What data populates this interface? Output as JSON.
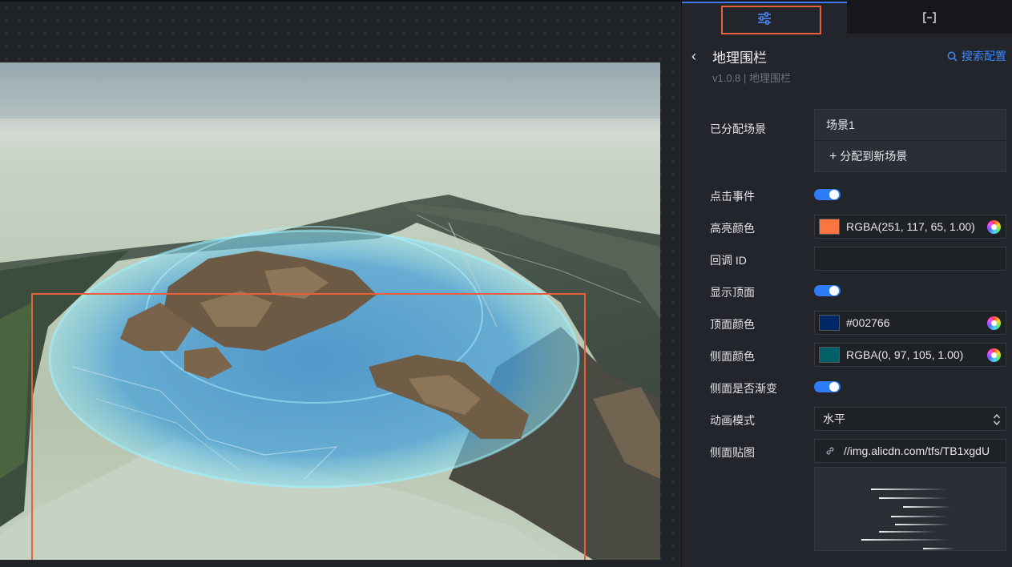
{
  "panel": {
    "tabs": [
      {
        "icon": "sliders-icon"
      },
      {
        "icon": "collapse-icon"
      }
    ],
    "title": "地理围栏",
    "subtitle": "v1.0.8 | 地理围栏",
    "search_label": "搜索配置",
    "fields": {
      "scenes_label": "已分配场景",
      "scene_item": "场景1",
      "scene_add": "分配到新场景",
      "click_event_label": "点击事件",
      "click_event_on": true,
      "highlight_color_label": "高亮颜色",
      "highlight_color_value": "RGBA(251, 117, 65, 1.00)",
      "highlight_color_hex": "#fb7541",
      "callback_id_label": "回调 ID",
      "callback_id_value": "",
      "show_top_label": "显示顶面",
      "show_top_on": true,
      "top_color_label": "顶面颜色",
      "top_color_value": "#002766",
      "top_color_hex": "#002766",
      "side_color_label": "侧面颜色",
      "side_color_value": "RGBA(0, 97, 105, 1.00)",
      "side_color_hex": "#006169",
      "side_gradient_label": "侧面是否渐变",
      "side_gradient_on": true,
      "anim_mode_label": "动画模式",
      "anim_mode_value": "水平",
      "side_texture_label": "侧面贴图",
      "side_texture_value": "//img.alicdn.com/tfs/TB1xgdU"
    }
  },
  "colors": {
    "accent": "#2f7df6",
    "selection": "#e8603a",
    "panel_bg": "#22252b"
  }
}
